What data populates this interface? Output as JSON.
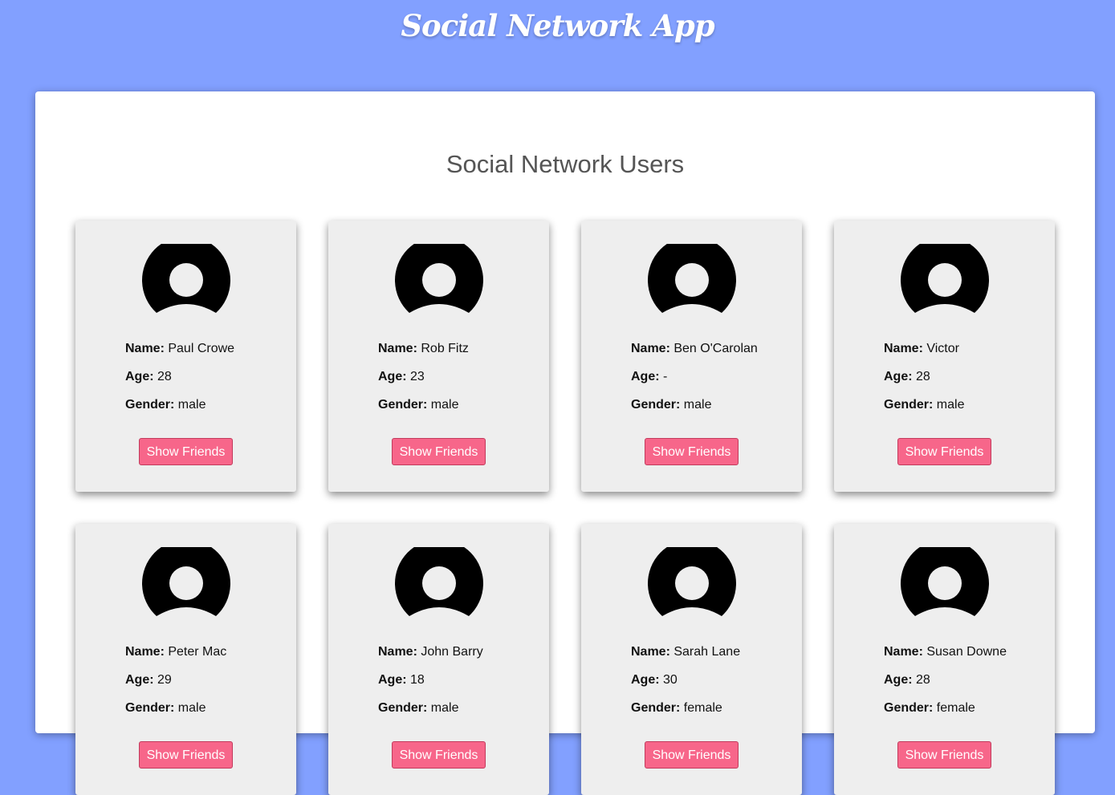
{
  "app": {
    "title": "Social Network App"
  },
  "main": {
    "title": "Social Network Users",
    "button_label": "Show Friends",
    "labels": {
      "name": "Name:",
      "age": "Age:",
      "gender": "Gender:"
    },
    "users": [
      {
        "name": "Paul Crowe",
        "age": "28",
        "gender": "male"
      },
      {
        "name": "Rob Fitz",
        "age": "23",
        "gender": "male"
      },
      {
        "name": "Ben O'Carolan",
        "age": "-",
        "gender": "male"
      },
      {
        "name": "Victor",
        "age": "28",
        "gender": "male"
      },
      {
        "name": "Peter Mac",
        "age": "29",
        "gender": "male"
      },
      {
        "name": "John Barry",
        "age": "18",
        "gender": "male"
      },
      {
        "name": "Sarah Lane",
        "age": "30",
        "gender": "female"
      },
      {
        "name": "Susan Downe",
        "age": "28",
        "gender": "female"
      }
    ]
  },
  "colors": {
    "background": "#82a0ff",
    "card": "#eeeeee",
    "button": "#f7668a"
  },
  "icons": {
    "avatar": "user-avatar-icon"
  }
}
